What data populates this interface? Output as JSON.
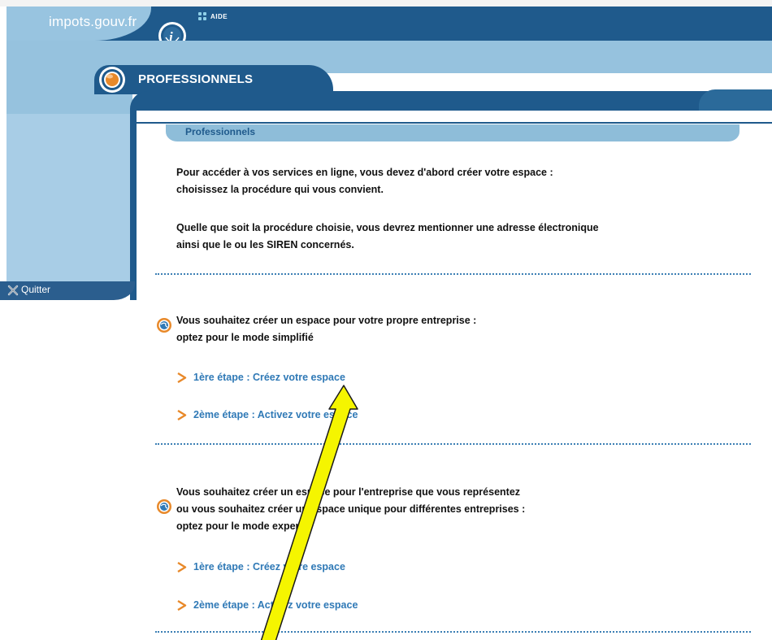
{
  "header": {
    "site_name": "impots.gouv.fr",
    "help_label": "AIDE"
  },
  "sidebar": {
    "quit_label": "Quitter"
  },
  "section": {
    "title": "PROFESSIONNELS",
    "breadcrumb": "Professionnels"
  },
  "intro": {
    "line1": "Pour accéder à vos services en ligne, vous devez d'abord créer votre espace :",
    "line2": "choisissez la procédure qui vous convient.",
    "line3": "Quelle que soit la procédure choisie, vous devrez mentionner une adresse électronique",
    "line4": "ainsi que le ou les SIREN concernés."
  },
  "mode_simple": {
    "line1": "Vous souhaitez créer un espace pour votre propre entreprise :",
    "line2": "optez pour le mode simplifié",
    "step1": "1ère étape : Créez votre espace",
    "step2": "2ème étape : Activez votre espace"
  },
  "mode_expert": {
    "line1": "Vous souhaitez créer un espace pour l'entreprise que vous représentez",
    "line2": "ou vous souhaitez créer un espace unique pour différentes entreprises :",
    "line3": "optez pour le mode expert",
    "step1": "1ère étape : Créez votre espace",
    "step2": "2ème étape : Activez votre espace"
  },
  "colors": {
    "header_dark": "#1f5a8c",
    "header_light": "#96c2de",
    "link": "#2f79b6",
    "step_chevron": "#e8892a",
    "annotation_arrow": "#f5f500"
  }
}
